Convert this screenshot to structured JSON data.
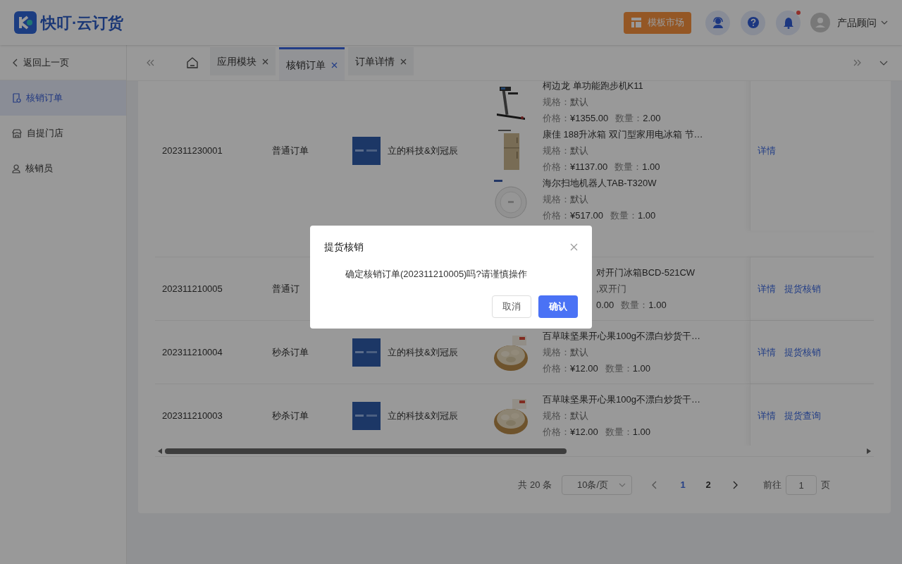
{
  "header": {
    "logo_text": "快叮·云订货",
    "template_button": "模板市场",
    "has_unread": true,
    "user_name": "产品顾问"
  },
  "sidebar": {
    "back": "返回上一页",
    "items": [
      {
        "label": "核销订单",
        "selected": true
      },
      {
        "label": "自提门店",
        "selected": false
      },
      {
        "label": "核销员",
        "selected": false
      }
    ]
  },
  "tabs": [
    {
      "label": "应用模块",
      "selected": false
    },
    {
      "label": "核销订单",
      "selected": true
    },
    {
      "label": "订单详情",
      "selected": false
    }
  ],
  "table": {
    "rows": [
      {
        "order_no": "202311230001",
        "type": "普通订单",
        "shop_name": "立的科技&刘冠辰",
        "covered": false,
        "products": [
          {
            "name": "柯边龙 单功能跑步机K11",
            "spec_label": "规格：",
            "spec": "默认",
            "price_label": "价格：",
            "price": "¥1355.00",
            "qty_label": "数量：",
            "qty": "2.00"
          },
          {
            "name": "康佳 188升冰箱 双门型家用电冰箱 节…",
            "spec_label": "规格：",
            "spec": "默认",
            "price_label": "价格：",
            "price": "¥1137.00",
            "qty_label": "数量：",
            "qty": "1.00"
          },
          {
            "name": "海尔扫地机器人TAB-T320W",
            "spec_label": "规格：",
            "spec": "默认",
            "price_label": "价格：",
            "price": "¥517.00",
            "qty_label": "数量：",
            "qty": "1.00"
          }
        ],
        "actions": [
          "详情"
        ]
      },
      {
        "order_no": "202311210005",
        "type": "普通订",
        "covered": true,
        "products": [
          {
            "name": "对开门冰箱BCD-521CW",
            "spec": ",双开门",
            "price": "0.00",
            "qty_label": "数量：",
            "qty": "1.00"
          }
        ],
        "actions": [
          "详情",
          "提货核销"
        ]
      },
      {
        "order_no": "202311210004",
        "type": "秒杀订单",
        "shop_name": "立的科技&刘冠辰",
        "covered": false,
        "products": [
          {
            "name": "百草味坚果开心果100g不漂白炒货干…",
            "spec_label": "规格：",
            "spec": "默认",
            "price_label": "价格：",
            "price": "¥12.00",
            "qty_label": "数量：",
            "qty": "1.00"
          }
        ],
        "actions": [
          "详情",
          "提货核销"
        ]
      },
      {
        "order_no": "202311210003",
        "type": "秒杀订单",
        "shop_name": "立的科技&刘冠辰",
        "covered": false,
        "products": [
          {
            "name": "百草味坚果开心果100g不漂白炒货干…",
            "spec_label": "规格：",
            "spec": "默认",
            "price_label": "价格：",
            "price": "¥12.00",
            "qty_label": "数量：",
            "qty": "1.00"
          }
        ],
        "actions": [
          "详情",
          "提货查询"
        ]
      }
    ]
  },
  "pagination": {
    "total": "共 20 条",
    "page_size": "10条/页",
    "pages": [
      {
        "label": "1",
        "selected": true
      },
      {
        "label": "2",
        "selected": false
      }
    ],
    "goto_label": "前往",
    "goto_value": "1",
    "goto_suffix": "页"
  },
  "dialog": {
    "title": "提货核销",
    "message": "确定核销订单(202311210005)吗?请谨慎操作",
    "cancel": "取消",
    "confirm": "确认"
  }
}
